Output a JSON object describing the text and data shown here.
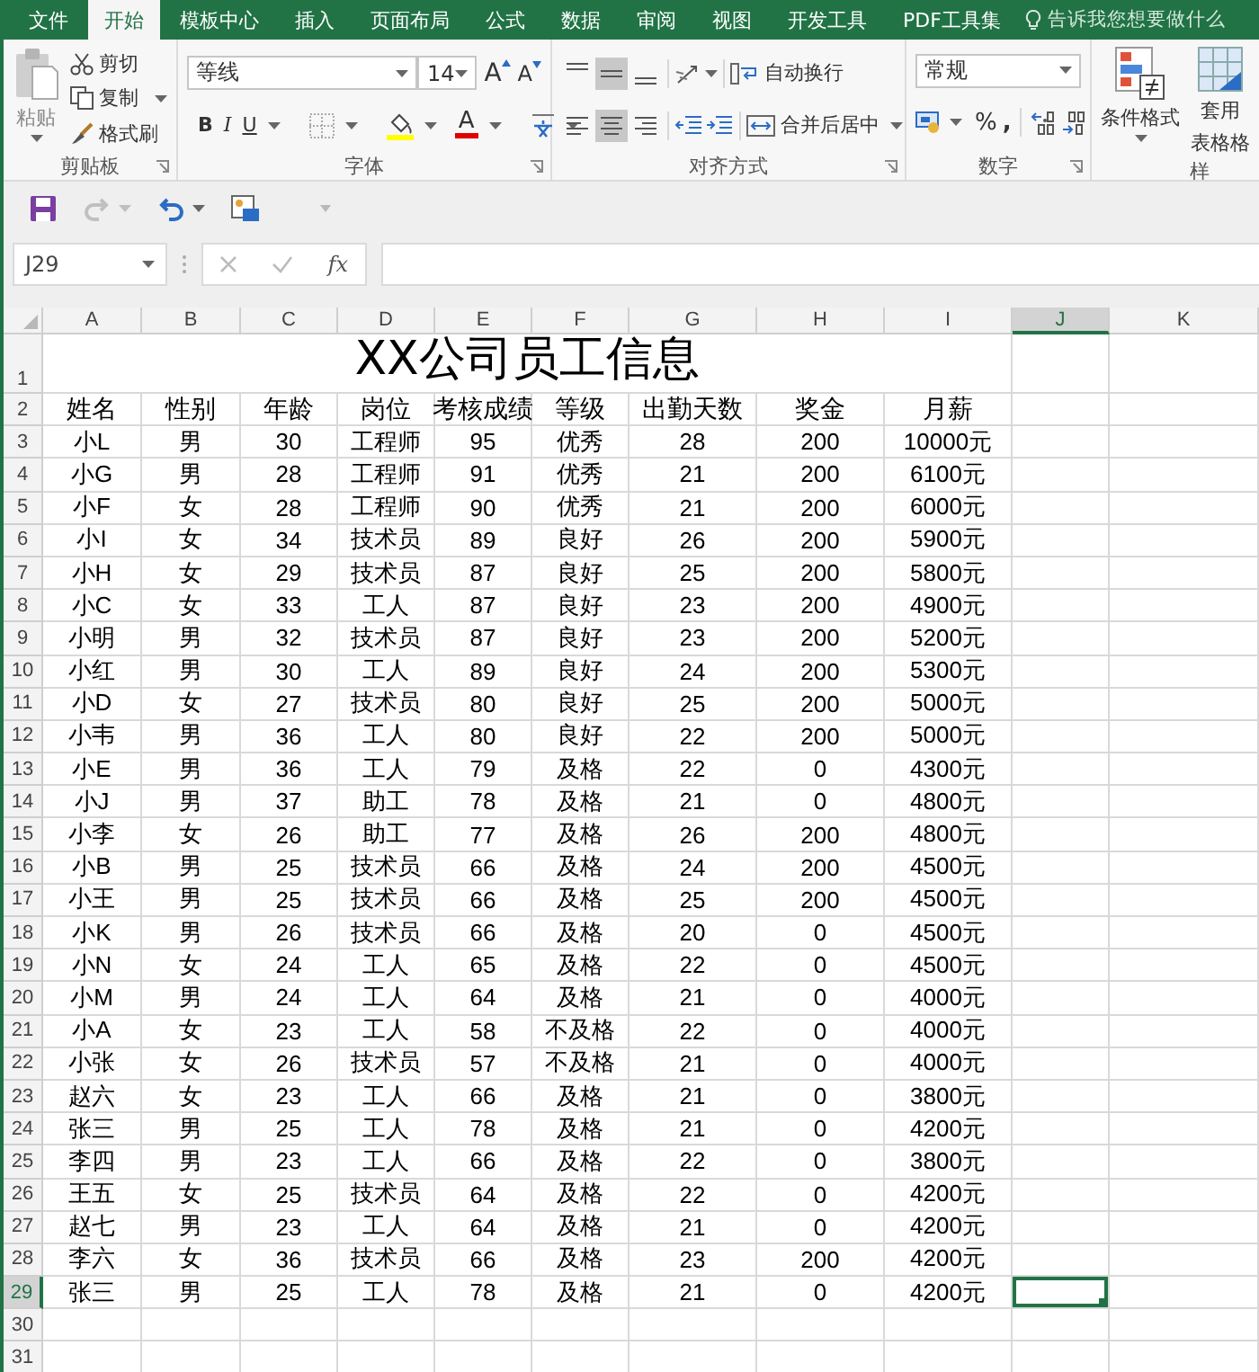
{
  "tabs": [
    {
      "label": "文件",
      "selected": false
    },
    {
      "label": "开始",
      "selected": true
    },
    {
      "label": "模板中心",
      "selected": false
    },
    {
      "label": "插入",
      "selected": false
    },
    {
      "label": "页面布局",
      "selected": false
    },
    {
      "label": "公式",
      "selected": false
    },
    {
      "label": "数据",
      "selected": false
    },
    {
      "label": "审阅",
      "selected": false
    },
    {
      "label": "视图",
      "selected": false
    },
    {
      "label": "开发工具",
      "selected": false
    },
    {
      "label": "PDF工具集",
      "selected": false
    }
  ],
  "tell_me": {
    "placeholder": "告诉我您想要做什么"
  },
  "ribbon": {
    "clipboard": {
      "label": "剪贴板",
      "paste": "粘贴",
      "cut": "剪切",
      "copy": "复制",
      "format_painter": "格式刷"
    },
    "font": {
      "label": "字体",
      "font_name": "等线",
      "font_size": "14",
      "grow": "A",
      "shrink": "A",
      "bold": "B",
      "italic": "I",
      "underline": "U",
      "font_color": "A"
    },
    "alignment": {
      "label": "对齐方式",
      "vertical": [
        {
          "selected": false
        },
        {
          "selected": true
        },
        {
          "selected": false
        }
      ],
      "horizontal": [
        {
          "selected": false
        },
        {
          "selected": true
        },
        {
          "selected": false
        }
      ],
      "wrap_text": "自动换行",
      "merge_center": "合并后居中"
    },
    "number": {
      "label": "数字",
      "format": "常规",
      "percent": "%",
      "comma": ","
    },
    "styles": {
      "label": "样",
      "conditional_formatting": "条件格式",
      "format_as_table": [
        "套用",
        "表格格"
      ]
    }
  },
  "quick_access": [
    {
      "kind": "save",
      "disabled": false
    },
    {
      "kind": "redo",
      "disabled": true
    },
    {
      "kind": "undo",
      "disabled": false
    },
    {
      "kind": "preview",
      "disabled": false
    },
    {
      "kind": "customize",
      "disabled": true
    }
  ],
  "formula_bar": {
    "name_box": "J29",
    "fx": "fx"
  },
  "sheet": {
    "columns": [
      {
        "label": "A",
        "selected": false
      },
      {
        "label": "B",
        "selected": false
      },
      {
        "label": "C",
        "selected": false
      },
      {
        "label": "D",
        "selected": false
      },
      {
        "label": "E",
        "selected": false
      },
      {
        "label": "F",
        "selected": false
      },
      {
        "label": "G",
        "selected": false
      },
      {
        "label": "H",
        "selected": false
      },
      {
        "label": "I",
        "selected": false
      },
      {
        "label": "J",
        "selected": true
      },
      {
        "label": "K",
        "selected": false
      }
    ],
    "rows": [
      {
        "number": "1",
        "selected": false,
        "title": "XX公司员工信息"
      },
      {
        "number": "2",
        "selected": false,
        "cells": [
          "姓名",
          "性别",
          "年龄",
          "岗位",
          "考核成绩",
          "等级",
          "出勤天数",
          "奖金",
          "月薪"
        ]
      },
      {
        "number": "3",
        "selected": false,
        "cells": [
          "小L",
          "男",
          "30",
          "工程师",
          "95",
          "优秀",
          "28",
          "200",
          "10000元"
        ]
      },
      {
        "number": "4",
        "selected": false,
        "cells": [
          "小G",
          "男",
          "28",
          "工程师",
          "91",
          "优秀",
          "21",
          "200",
          "6100元"
        ]
      },
      {
        "number": "5",
        "selected": false,
        "cells": [
          "小F",
          "女",
          "28",
          "工程师",
          "90",
          "优秀",
          "21",
          "200",
          "6000元"
        ]
      },
      {
        "number": "6",
        "selected": false,
        "cells": [
          "小I",
          "女",
          "34",
          "技术员",
          "89",
          "良好",
          "26",
          "200",
          "5900元"
        ]
      },
      {
        "number": "7",
        "selected": false,
        "cells": [
          "小H",
          "女",
          "29",
          "技术员",
          "87",
          "良好",
          "25",
          "200",
          "5800元"
        ]
      },
      {
        "number": "8",
        "selected": false,
        "cells": [
          "小C",
          "女",
          "33",
          "工人",
          "87",
          "良好",
          "23",
          "200",
          "4900元"
        ]
      },
      {
        "number": "9",
        "selected": false,
        "cells": [
          "小明",
          "男",
          "32",
          "技术员",
          "87",
          "良好",
          "23",
          "200",
          "5200元"
        ]
      },
      {
        "number": "10",
        "selected": false,
        "cells": [
          "小红",
          "男",
          "30",
          "工人",
          "89",
          "良好",
          "24",
          "200",
          "5300元"
        ]
      },
      {
        "number": "11",
        "selected": false,
        "cells": [
          "小D",
          "女",
          "27",
          "技术员",
          "80",
          "良好",
          "25",
          "200",
          "5000元"
        ]
      },
      {
        "number": "12",
        "selected": false,
        "cells": [
          "小韦",
          "男",
          "36",
          "工人",
          "80",
          "良好",
          "22",
          "200",
          "5000元"
        ]
      },
      {
        "number": "13",
        "selected": false,
        "cells": [
          "小E",
          "男",
          "36",
          "工人",
          "79",
          "及格",
          "22",
          "0",
          "4300元"
        ]
      },
      {
        "number": "14",
        "selected": false,
        "cells": [
          "小J",
          "男",
          "37",
          "助工",
          "78",
          "及格",
          "21",
          "0",
          "4800元"
        ]
      },
      {
        "number": "15",
        "selected": false,
        "cells": [
          "小李",
          "女",
          "26",
          "助工",
          "77",
          "及格",
          "26",
          "200",
          "4800元"
        ]
      },
      {
        "number": "16",
        "selected": false,
        "cells": [
          "小B",
          "男",
          "25",
          "技术员",
          "66",
          "及格",
          "24",
          "200",
          "4500元"
        ]
      },
      {
        "number": "17",
        "selected": false,
        "cells": [
          "小王",
          "男",
          "25",
          "技术员",
          "66",
          "及格",
          "25",
          "200",
          "4500元"
        ]
      },
      {
        "number": "18",
        "selected": false,
        "cells": [
          "小K",
          "男",
          "26",
          "技术员",
          "66",
          "及格",
          "20",
          "0",
          "4500元"
        ]
      },
      {
        "number": "19",
        "selected": false,
        "cells": [
          "小N",
          "女",
          "24",
          "工人",
          "65",
          "及格",
          "22",
          "0",
          "4500元"
        ]
      },
      {
        "number": "20",
        "selected": false,
        "cells": [
          "小M",
          "男",
          "24",
          "工人",
          "64",
          "及格",
          "21",
          "0",
          "4000元"
        ]
      },
      {
        "number": "21",
        "selected": false,
        "cells": [
          "小A",
          "女",
          "23",
          "工人",
          "58",
          "不及格",
          "22",
          "0",
          "4000元"
        ]
      },
      {
        "number": "22",
        "selected": false,
        "cells": [
          "小张",
          "女",
          "26",
          "技术员",
          "57",
          "不及格",
          "21",
          "0",
          "4000元"
        ]
      },
      {
        "number": "23",
        "selected": false,
        "cells": [
          "赵六",
          "女",
          "23",
          "工人",
          "66",
          "及格",
          "21",
          "0",
          "3800元"
        ]
      },
      {
        "number": "24",
        "selected": false,
        "cells": [
          "张三",
          "男",
          "25",
          "工人",
          "78",
          "及格",
          "21",
          "0",
          "4200元"
        ]
      },
      {
        "number": "25",
        "selected": false,
        "cells": [
          "李四",
          "男",
          "23",
          "工人",
          "66",
          "及格",
          "22",
          "0",
          "3800元"
        ]
      },
      {
        "number": "26",
        "selected": false,
        "cells": [
          "王五",
          "女",
          "25",
          "技术员",
          "64",
          "及格",
          "22",
          "0",
          "4200元"
        ]
      },
      {
        "number": "27",
        "selected": false,
        "cells": [
          "赵七",
          "男",
          "23",
          "工人",
          "64",
          "及格",
          "21",
          "0",
          "4200元"
        ]
      },
      {
        "number": "28",
        "selected": false,
        "cells": [
          "李六",
          "女",
          "36",
          "技术员",
          "66",
          "及格",
          "23",
          "200",
          "4200元"
        ]
      },
      {
        "number": "29",
        "selected": true,
        "cells": [
          "张三",
          "男",
          "25",
          "工人",
          "78",
          "及格",
          "21",
          "0",
          "4200元"
        ]
      },
      {
        "number": "30",
        "selected": false
      },
      {
        "number": "31",
        "selected": false
      }
    ]
  }
}
